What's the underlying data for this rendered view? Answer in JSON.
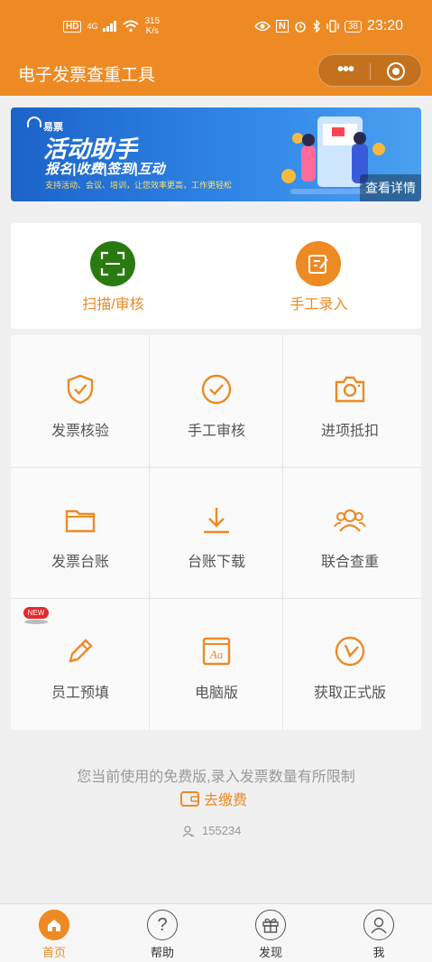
{
  "status_bar": {
    "hd": "HD",
    "network": "4G",
    "speed_value": "315",
    "speed_unit": "K/s",
    "nfc": "N",
    "battery": "38",
    "time": "23:20"
  },
  "header": {
    "title": "电子发票查重工具",
    "menu_dots": "•••"
  },
  "banner": {
    "brand": "易票",
    "headline": "活动助手",
    "tags": "报名|收费|签到|互动",
    "slogan": "支持活动、会议、培训，让您效率更高，工作更轻松",
    "detail_link": "查看详情"
  },
  "quick_actions": [
    {
      "label": "扫描/审核",
      "icon": "scan-icon",
      "color": "#2a7a12"
    },
    {
      "label": "手工录入",
      "icon": "edit-icon",
      "color": "#ee8a24"
    }
  ],
  "grid": [
    {
      "label": "发票核验",
      "icon": "shield-check-icon"
    },
    {
      "label": "手工审核",
      "icon": "check-circle-icon"
    },
    {
      "label": "进项抵扣",
      "icon": "camera-icon"
    },
    {
      "label": "发票台账",
      "icon": "folder-icon"
    },
    {
      "label": "台账下载",
      "icon": "download-icon"
    },
    {
      "label": "联合查重",
      "icon": "users-icon"
    },
    {
      "label": "员工预填",
      "icon": "pencil-icon"
    },
    {
      "label": "电脑版",
      "icon": "browser-icon",
      "icon_text": "Aa"
    },
    {
      "label": "获取正式版",
      "icon": "clock-icon"
    }
  ],
  "new_badge": "NEW",
  "footer_info": {
    "notice": "您当前使用的免费版,录入发票数量有所限制",
    "pay_link": "去缴费",
    "user_id": "155234"
  },
  "tabbar": [
    {
      "label": "首页",
      "icon": "home-icon",
      "active": true
    },
    {
      "label": "帮助",
      "icon": "help-icon",
      "icon_text": "?"
    },
    {
      "label": "发现",
      "icon": "gift-icon"
    },
    {
      "label": "我",
      "icon": "user-icon"
    }
  ],
  "colors": {
    "brand": "#ee8a24",
    "scan_green": "#2a7a12",
    "banner_blue": "#1c63c9"
  }
}
